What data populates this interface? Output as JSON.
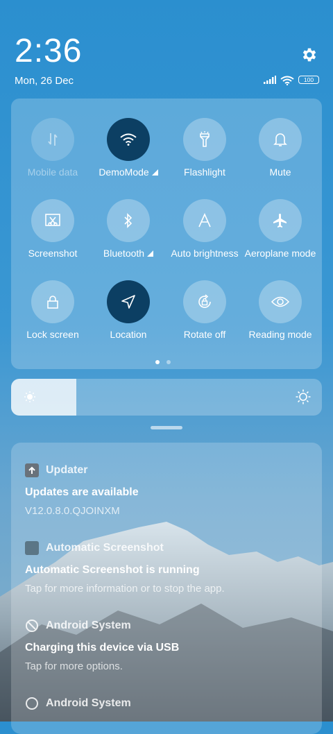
{
  "status": {
    "time": "2:36",
    "date": "Mon, 26 Dec",
    "battery": "100"
  },
  "tiles": [
    {
      "label": "Mobile data",
      "icon": "mobile-data-icon",
      "state": "disabled"
    },
    {
      "label": "DemoMode",
      "icon": "wifi-icon",
      "state": "active"
    },
    {
      "label": "Flashlight",
      "icon": "flashlight-icon",
      "state": "off"
    },
    {
      "label": "Mute",
      "icon": "bell-icon",
      "state": "off"
    },
    {
      "label": "Screenshot",
      "icon": "screenshot-icon",
      "state": "off"
    },
    {
      "label": "Bluetooth",
      "icon": "bluetooth-icon",
      "state": "off"
    },
    {
      "label": "Auto brightness",
      "icon": "auto-brightness-icon",
      "state": "off"
    },
    {
      "label": "Aeroplane mode",
      "icon": "airplane-icon",
      "state": "off"
    },
    {
      "label": "Lock screen",
      "icon": "lock-icon",
      "state": "off"
    },
    {
      "label": "Location",
      "icon": "location-arrow-icon",
      "state": "active"
    },
    {
      "label": "Rotate off",
      "icon": "rotate-lock-icon",
      "state": "off"
    },
    {
      "label": "Reading mode",
      "icon": "eye-icon",
      "state": "off"
    }
  ],
  "pager": {
    "pages": 2,
    "current": 1
  },
  "brightness": {
    "level": 0.21
  },
  "notifications": [
    {
      "app": "Updater",
      "title": "Updates are available",
      "body": "V12.0.8.0.QJOINXM"
    },
    {
      "app": "Automatic Screenshot",
      "title": "Automatic Screenshot is running",
      "body": "Tap for more information or to stop the app."
    },
    {
      "app": "Android System",
      "title": "Charging this device via USB",
      "body": "Tap for more options."
    },
    {
      "app": "Android System",
      "title": "",
      "body": ""
    }
  ],
  "colors": {
    "active_tile": "#0c3f63",
    "background": "#2b8fcf"
  }
}
